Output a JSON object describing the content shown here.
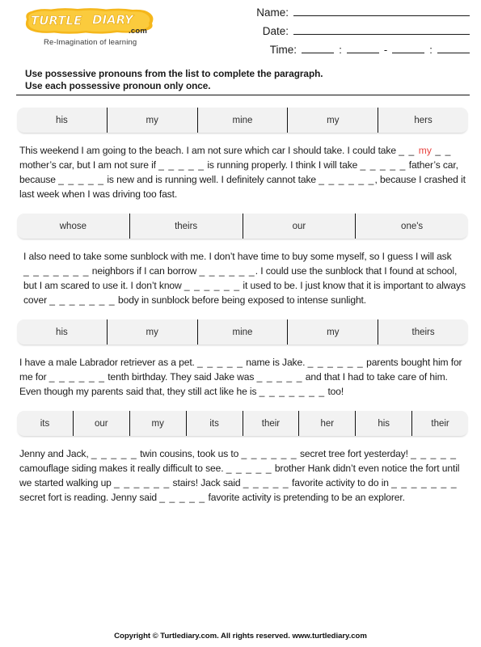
{
  "brand": {
    "logo_text": "TURTLE DIARY",
    "logo_suffix": ".com",
    "tagline": "Re-Imagination of learning",
    "logo_color": "#f5b71b",
    "logo_letter_color": "#ffffff"
  },
  "header_fields": [
    {
      "label": "Name:",
      "value": ""
    },
    {
      "label": "Date:",
      "value": ""
    },
    {
      "label": "Time:",
      "value": ""
    }
  ],
  "time_separators": [
    ":",
    "-",
    ":"
  ],
  "instructions": {
    "line1": "Use possessive pronouns from the list to complete the paragraph.",
    "line2": "Use each possessive pronoun only once."
  },
  "answer_color": "#e8433f",
  "sections": [
    {
      "word_bank": [
        "his",
        "my",
        "mine",
        "my",
        "hers"
      ],
      "paragraph": [
        {
          "type": "text",
          "text": "This weekend I am going to the beach. I am not sure which car I should take. I could take "
        },
        {
          "type": "blank",
          "text": "_ _ "
        },
        {
          "type": "answer",
          "text": "my"
        },
        {
          "type": "blank",
          "text": " _ _"
        },
        {
          "type": "text",
          "text": " mother’s car, but I am not sure if "
        },
        {
          "type": "blank",
          "text": "_ _ _ _ _"
        },
        {
          "type": "text",
          "text": " is running properly. I think I will take "
        },
        {
          "type": "blank",
          "text": "_ _ _ _ _"
        },
        {
          "type": "text",
          "text": " father’s car, because "
        },
        {
          "type": "blank",
          "text": "_ _ _ _ _"
        },
        {
          "type": "text",
          "text": " is new and is running well. I definitely cannot take "
        },
        {
          "type": "blank",
          "text": "_ _ _ _ _ _"
        },
        {
          "type": "text",
          "text": ", because I crashed it last week when I was driving too fast."
        }
      ]
    },
    {
      "word_bank": [
        "whose",
        "theirs",
        "our",
        "one's"
      ],
      "paragraph": [
        {
          "type": "text",
          "text": "I also need to take some sunblock with me. I don’t have time to buy some myself, so I guess I will ask "
        },
        {
          "type": "blank",
          "text": "_ _ _ _ _ _ _"
        },
        {
          "type": "text",
          "text": " neighbors if I can borrow "
        },
        {
          "type": "blank",
          "text": "_ _ _ _ _ _"
        },
        {
          "type": "text",
          "text": ". I could use the sunblock that I found at school, but I am scared to use it. I don’t know "
        },
        {
          "type": "blank",
          "text": "_ _ _ _ _ _"
        },
        {
          "type": "text",
          "text": " it used to be. I just know that it is important to always cover "
        },
        {
          "type": "blank",
          "text": "_ _ _ _ _ _ _"
        },
        {
          "type": "text",
          "text": " body in sunblock before being exposed to intense sunlight."
        }
      ]
    },
    {
      "word_bank": [
        "his",
        "my",
        "mine",
        "my",
        "theirs"
      ],
      "paragraph": [
        {
          "type": "text",
          "text": "I have a male Labrador retriever as a pet. "
        },
        {
          "type": "blank",
          "text": "_ _ _ _ _"
        },
        {
          "type": "text",
          "text": " name is Jake. "
        },
        {
          "type": "blank",
          "text": "_ _ _ _ _ _"
        },
        {
          "type": "text",
          "text": " parents bought him for me for "
        },
        {
          "type": "blank",
          "text": "_ _ _ _ _ _"
        },
        {
          "type": "text",
          "text": " tenth birthday. They said Jake was "
        },
        {
          "type": "blank",
          "text": "_ _ _ _ _"
        },
        {
          "type": "text",
          "text": " and that I had to take care of him. Even though my parents said that, they still act like he is "
        },
        {
          "type": "blank",
          "text": "_ _ _ _ _ _ _"
        },
        {
          "type": "text",
          "text": " too!"
        }
      ]
    },
    {
      "word_bank": [
        "its",
        "our",
        "my",
        "its",
        "their",
        "her",
        "his",
        "their"
      ],
      "paragraph": [
        {
          "type": "text",
          "text": "Jenny and Jack, "
        },
        {
          "type": "blank",
          "text": "_ _ _ _ _"
        },
        {
          "type": "text",
          "text": " twin cousins, took us to "
        },
        {
          "type": "blank",
          "text": "_ _ _ _ _ _"
        },
        {
          "type": "text",
          "text": " secret tree fort yesterday! "
        },
        {
          "type": "blank",
          "text": "_ _ _ _ _"
        },
        {
          "type": "text",
          "text": " camouflage siding makes it really difficult to see. "
        },
        {
          "type": "blank",
          "text": "_ _ _ _ _"
        },
        {
          "type": "text",
          "text": " brother Hank didn’t even notice the fort until we started walking up "
        },
        {
          "type": "blank",
          "text": "_ _ _ _ _ _"
        },
        {
          "type": "text",
          "text": " stairs! Jack said "
        },
        {
          "type": "blank",
          "text": "_ _ _ _ _"
        },
        {
          "type": "text",
          "text": " favorite activity to do in "
        },
        {
          "type": "blank",
          "text": "_ _ _ _ _ _ _"
        },
        {
          "type": "text",
          "text": " secret fort is reading. Jenny said "
        },
        {
          "type": "blank",
          "text": "_ _ _ _ _"
        },
        {
          "type": "text",
          "text": " favorite activity is pretending to be an explorer."
        }
      ]
    }
  ],
  "footer": {
    "text": "Copyright © Turtlediary.com. All rights reserved. www.turtlediary.com"
  }
}
